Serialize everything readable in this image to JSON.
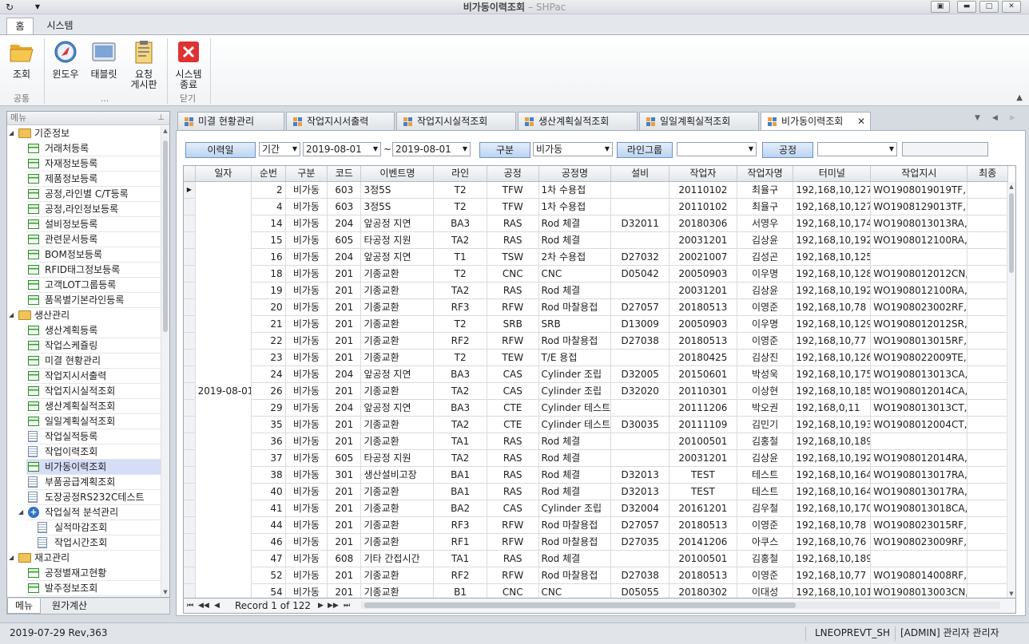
{
  "window": {
    "title": "비가동이력조회",
    "subtitle": "– SHPac"
  },
  "ribbon_tabs": [
    "홈",
    "시스템"
  ],
  "ribbon": {
    "buttons": [
      {
        "label1": "조회",
        "label2": ""
      },
      {
        "label1": "윈도우",
        "label2": ""
      },
      {
        "label1": "태블릿",
        "label2": ""
      },
      {
        "label1": "요청",
        "label2": "게시판"
      },
      {
        "label1": "시스템",
        "label2": "종료"
      }
    ],
    "groups": [
      "공통",
      "...",
      "닫기"
    ]
  },
  "left_panel": {
    "title": "메뉴",
    "tree": [
      {
        "label": "기준정보",
        "type": "folder",
        "level": 0
      },
      {
        "label": "거래처등록",
        "type": "sheet",
        "level": 1
      },
      {
        "label": "자재정보등록",
        "type": "sheet",
        "level": 1
      },
      {
        "label": "제품정보등록",
        "type": "sheet",
        "level": 1
      },
      {
        "label": "공정,라인별 C/T등록",
        "type": "sheet",
        "level": 1
      },
      {
        "label": "공정,라인정보등록",
        "type": "sheet",
        "level": 1
      },
      {
        "label": "설비정보등록",
        "type": "sheet",
        "level": 1
      },
      {
        "label": "관련문서등록",
        "type": "sheet",
        "level": 1
      },
      {
        "label": "BOM정보등록",
        "type": "sheet",
        "level": 1
      },
      {
        "label": "RFID태그정보등록",
        "type": "sheet",
        "level": 1
      },
      {
        "label": "고객LOT그룹등록",
        "type": "sheet",
        "level": 1
      },
      {
        "label": "품목별기본라인등록",
        "type": "sheet",
        "level": 1
      },
      {
        "label": "생산관리",
        "type": "folder",
        "level": 0
      },
      {
        "label": "생산계획등록",
        "type": "sheet",
        "level": 1
      },
      {
        "label": "작업스케쥴링",
        "type": "sheet",
        "level": 1
      },
      {
        "label": "미결 현황관리",
        "type": "sheet",
        "level": 1
      },
      {
        "label": "작업지시서출력",
        "type": "sheet",
        "level": 1
      },
      {
        "label": "작업지시실적조회",
        "type": "sheet",
        "level": 1
      },
      {
        "label": "생산계획실적조회",
        "type": "sheet",
        "level": 1
      },
      {
        "label": "일일계획실적조회",
        "type": "sheet",
        "level": 1
      },
      {
        "label": "작업실적등록",
        "type": "doc",
        "level": 1
      },
      {
        "label": "작업이력조회",
        "type": "doc",
        "level": 1
      },
      {
        "label": "비가동이력조회",
        "type": "sheet",
        "level": 1,
        "selected": true
      },
      {
        "label": "부품공급계획조회",
        "type": "doc",
        "level": 1
      },
      {
        "label": "도장공정RS232C테스트",
        "type": "doc",
        "level": 1
      },
      {
        "label": "작업실적 분석관리",
        "type": "plus",
        "level": 1
      },
      {
        "label": "실적마감조회",
        "type": "doc",
        "level": 2
      },
      {
        "label": "작업시간조회",
        "type": "doc",
        "level": 2
      },
      {
        "label": "재고관리",
        "type": "folder",
        "level": 0
      },
      {
        "label": "공정별재고현황",
        "type": "sheet",
        "level": 1
      },
      {
        "label": "발주정보조회",
        "type": "sheet",
        "level": 1
      }
    ],
    "bottom_tabs": [
      "메뉴",
      "원가계산"
    ]
  },
  "doc_tabs": [
    "미결 현황관리",
    "작업지시서출력",
    "작업지시실적조회",
    "생산계획실적조회",
    "일일계획실적조회",
    "비가동이력조회"
  ],
  "filters": {
    "history_button": "이력일",
    "period_value": "기간",
    "date_from": "2019-08-01",
    "tilde": "~",
    "date_to": "2019-08-01",
    "type_button": "구분",
    "type_value": "비가동",
    "line_group_button": "라인그룹",
    "line_group_value": "",
    "process_button": "공정",
    "process_value": ""
  },
  "grid": {
    "columns": [
      "일자",
      "순번",
      "구분",
      "코드",
      "이벤트명",
      "라인",
      "공정",
      "공정명",
      "설비",
      "작업자",
      "작업자명",
      "터미널",
      "작업지시",
      "최종"
    ],
    "date_merged": "2019-08-01",
    "rows": [
      [
        "2",
        "비가동",
        "603",
        "3정5S",
        "T2",
        "TFW",
        "1차 수용접",
        "",
        "20110102",
        "최율구",
        "192,168,10,127",
        "WO1908019019TF,..."
      ],
      [
        "4",
        "비가동",
        "603",
        "3정5S",
        "T2",
        "TFW",
        "1차 수용접",
        "",
        "20110102",
        "최율구",
        "192,168,10,127",
        "WO1908129013TF,..."
      ],
      [
        "14",
        "비가동",
        "204",
        "앞공정 지연",
        "BA3",
        "RAS",
        "Rod 체결",
        "D32011",
        "20180306",
        "서영우",
        "192,168,10,174",
        "WO1908013013RA,..."
      ],
      [
        "15",
        "비가동",
        "605",
        "타공정 지원",
        "TA2",
        "RAS",
        "Rod 체결",
        "",
        "20031201",
        "김상윤",
        "192,168,10,192",
        "WO1908012100RA,..."
      ],
      [
        "16",
        "비가동",
        "204",
        "앞공정 지연",
        "T1",
        "TSW",
        "2차 수용접",
        "D27032",
        "20021007",
        "김성곤",
        "192,168,10,125",
        ""
      ],
      [
        "18",
        "비가동",
        "201",
        "기종교환",
        "T2",
        "CNC",
        "CNC",
        "D05042",
        "20050903",
        "이우명",
        "192,168,10,128",
        "WO1908012012CN,..."
      ],
      [
        "19",
        "비가동",
        "201",
        "기종교환",
        "TA2",
        "RAS",
        "Rod 체결",
        "",
        "20031201",
        "김상윤",
        "192,168,10,192",
        "WO1908012100RA,..."
      ],
      [
        "20",
        "비가동",
        "201",
        "기종교환",
        "RF3",
        "RFW",
        "Rod 마찰용접",
        "D27057",
        "20180513",
        "이영준",
        "192,168,10,78",
        "WO1908023002RF,..."
      ],
      [
        "21",
        "비가동",
        "201",
        "기종교환",
        "T2",
        "SRB",
        "SRB",
        "D13009",
        "20050903",
        "이우명",
        "192,168,10,129",
        "WO1908012012SR,..."
      ],
      [
        "22",
        "비가동",
        "201",
        "기종교환",
        "RF2",
        "RFW",
        "Rod 마찰용접",
        "D27038",
        "20180513",
        "이영준",
        "192,168,10,77",
        "WO1908013015RF,..."
      ],
      [
        "23",
        "비가동",
        "201",
        "기종교환",
        "T2",
        "TEW",
        "T/E 용접",
        "",
        "20180425",
        "김상진",
        "192,168,10,126",
        "WO1908022009TE,..."
      ],
      [
        "24",
        "비가동",
        "204",
        "앞공정 지연",
        "BA3",
        "CAS",
        "Cylinder 조립",
        "D32005",
        "20150601",
        "박성욱",
        "192,168,10,175",
        "WO1908013013CA,..."
      ],
      [
        "26",
        "비가동",
        "201",
        "기종교환",
        "TA2",
        "CAS",
        "Cylinder 조립",
        "D32020",
        "20110301",
        "이상현",
        "192,168,10,185",
        "WO1908012014CA,..."
      ],
      [
        "29",
        "비가동",
        "204",
        "앞공정 지연",
        "BA3",
        "CTE",
        "Cylinder 테스트",
        "",
        "20111206",
        "박오권",
        "192,168,0,11",
        "WO1908013013CT,..."
      ],
      [
        "35",
        "비가동",
        "201",
        "기종교환",
        "TA2",
        "CTE",
        "Cylinder 테스트",
        "D30035",
        "20111109",
        "김민기",
        "192,168,10,193",
        "WO1908012004CT,..."
      ],
      [
        "36",
        "비가동",
        "201",
        "기종교환",
        "TA1",
        "RAS",
        "Rod 체결",
        "",
        "20100501",
        "김홍철",
        "192,168,10,189",
        ""
      ],
      [
        "37",
        "비가동",
        "605",
        "타공정 지원",
        "TA2",
        "RAS",
        "Rod 체결",
        "",
        "20031201",
        "김상윤",
        "192,168,10,192",
        "WO1908012014RA,..."
      ],
      [
        "38",
        "비가동",
        "301",
        "생산설비고장",
        "BA1",
        "RAS",
        "Rod 체결",
        "D32013",
        "TEST",
        "테스트",
        "192,168,10,164",
        "WO1908013017RA,..."
      ],
      [
        "40",
        "비가동",
        "201",
        "기종교환",
        "BA1",
        "RAS",
        "Rod 체결",
        "D32013",
        "TEST",
        "테스트",
        "192,168,10,164",
        "WO1908013017RA,..."
      ],
      [
        "41",
        "비가동",
        "201",
        "기종교환",
        "BA2",
        "CAS",
        "Cylinder 조립",
        "D32004",
        "20161201",
        "김우철",
        "192,168,10,170",
        "WO1908013018CA,..."
      ],
      [
        "44",
        "비가동",
        "201",
        "기종교환",
        "RF3",
        "RFW",
        "Rod 마찰용접",
        "D27057",
        "20180513",
        "이영준",
        "192,168,10,78",
        "WO1908023015RF,..."
      ],
      [
        "46",
        "비가동",
        "201",
        "기종교환",
        "RF1",
        "RFW",
        "Rod 마찰용접",
        "D27035",
        "20141206",
        "아쿠스",
        "192,168,10,76",
        "WO1908023009RF,..."
      ],
      [
        "47",
        "비가동",
        "608",
        "기타 간접시간",
        "TA1",
        "RAS",
        "Rod 체결",
        "",
        "20100501",
        "김홍철",
        "192,168,10,189",
        ""
      ],
      [
        "52",
        "비가동",
        "201",
        "기종교환",
        "RF2",
        "RFW",
        "Rod 마찰용접",
        "D27038",
        "20180513",
        "이영준",
        "192,168,10,77",
        "WO1908014008RF,..."
      ],
      [
        "54",
        "비가동",
        "201",
        "기종교환",
        "B1",
        "CNC",
        "CNC",
        "D05055",
        "20180302",
        "이대성",
        "192,168,10,101",
        "WO1908013003CN,..."
      ]
    ]
  },
  "navigator": {
    "record_text": "Record 1 of 122"
  },
  "status": {
    "left": "2019-07-29 Rev,363",
    "server": "LNEOPREVT_SH",
    "user": "[ADMIN] 관리자 관리자"
  }
}
